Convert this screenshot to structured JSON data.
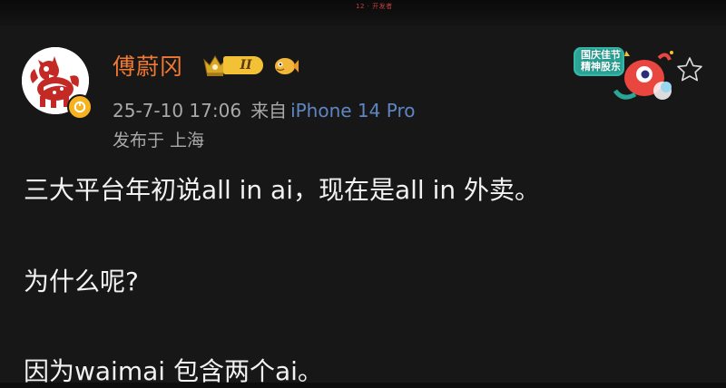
{
  "window": {
    "center_mark": "12 · 开发者"
  },
  "post": {
    "author": "傅蔚冈",
    "level": "II",
    "date": "25-7-10 17:06",
    "via": "来自",
    "device": "iPhone 14 Pro",
    "location": "发布于 上海",
    "sticker_text": "国庆佳节 精神股东",
    "lines": [
      "三大平台年初说all in ai，现在是all in 外卖。",
      "为什么呢?",
      "因为waimai 包含两个ai。"
    ]
  },
  "colors": {
    "author": "#f07a33",
    "device": "#5f86c2",
    "meta": "#a9a9a9",
    "text": "#f2f2f2",
    "background": "#171717"
  },
  "icons": [
    "crown-icon",
    "fish-icon",
    "verified-badge-icon",
    "star-icon",
    "holiday-sticker"
  ]
}
